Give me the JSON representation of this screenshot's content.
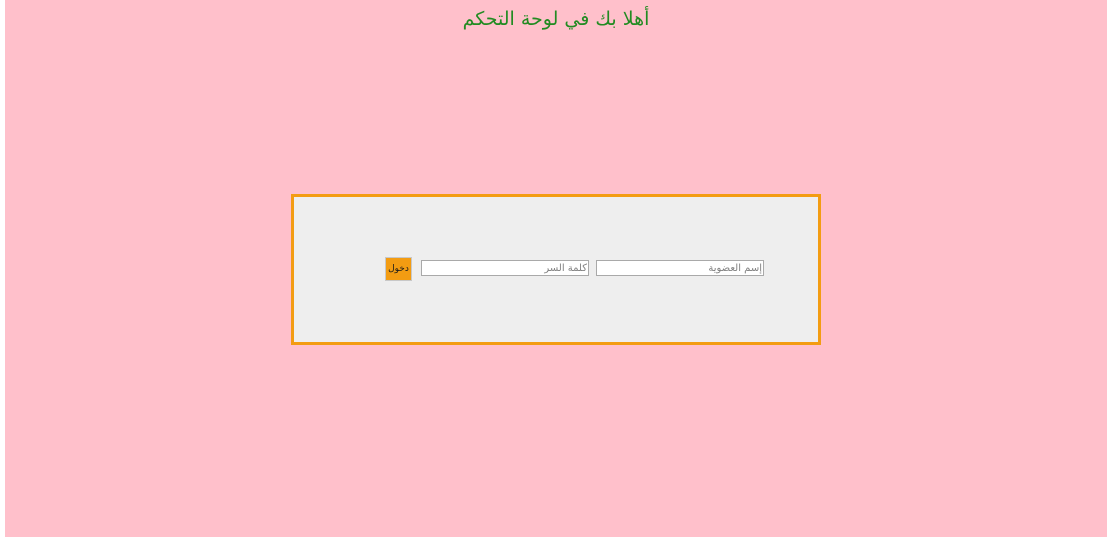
{
  "header": {
    "title": "أهلا بك في لوحة التحكم"
  },
  "login_form": {
    "username": {
      "value": "",
      "placeholder": "إسم العضوية"
    },
    "password": {
      "value": "",
      "placeholder": "كلمة السر"
    },
    "submit_label": "دخول"
  },
  "colors": {
    "page_background": "#ffc0cb",
    "title_text": "#228b22",
    "box_background": "#eeeeee",
    "accent": "#f39c12"
  }
}
